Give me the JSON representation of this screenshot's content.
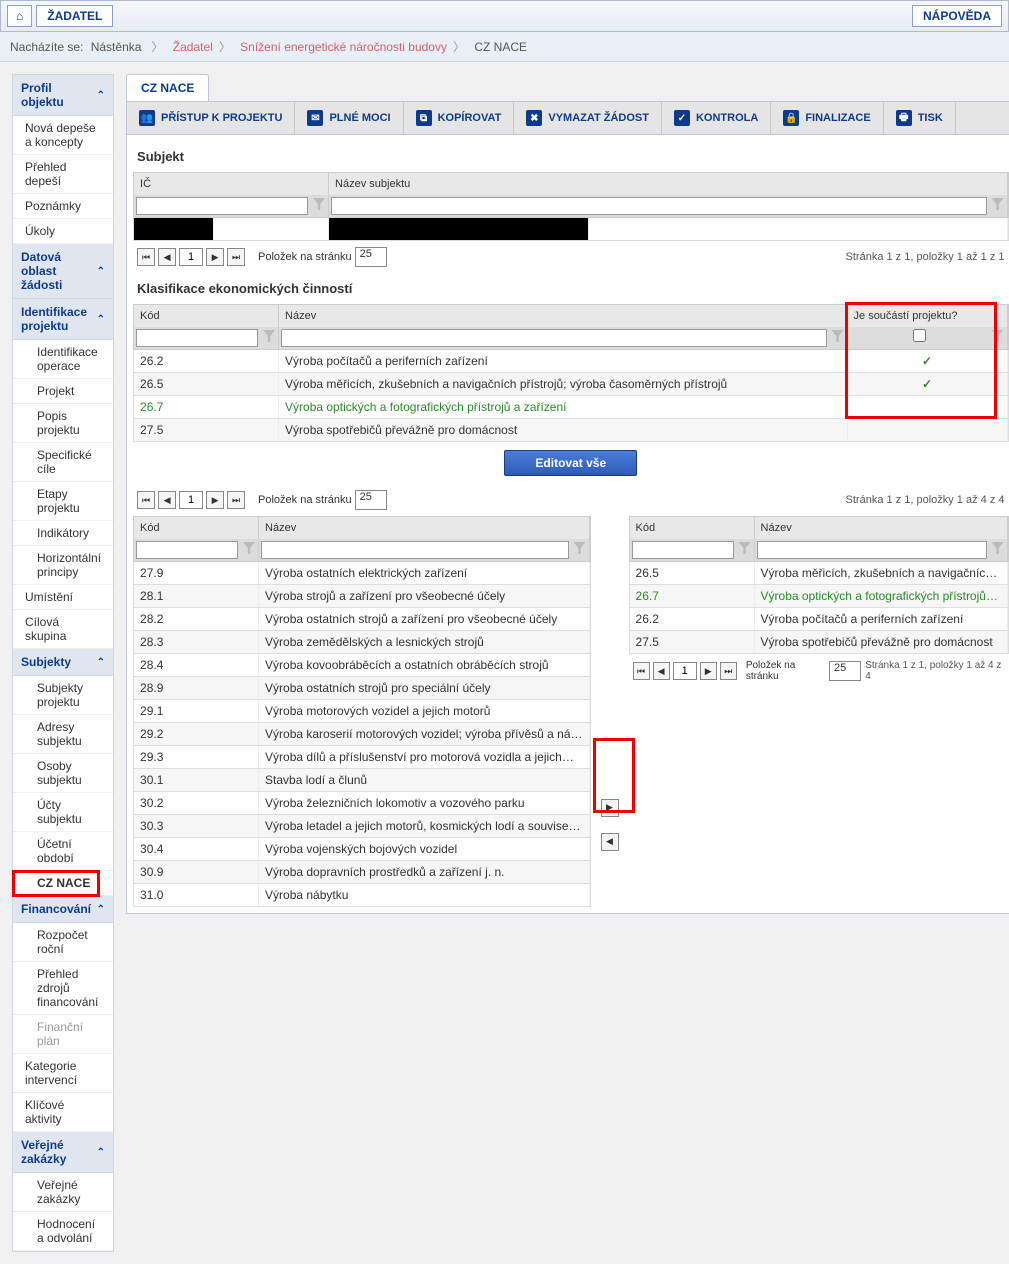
{
  "topbar": {
    "home": "⌂",
    "zadatel": "ŽADATEL",
    "napoveda": "NÁPOVĚDA"
  },
  "breadcrumb": {
    "label": "Nacházíte se:",
    "items": [
      "Nástěnka",
      "Žadatel",
      "Snížení energetické náročnosti budovy",
      "CZ NACE"
    ]
  },
  "sidebar": {
    "groups": [
      {
        "title": "Profil objektu",
        "items": [
          "Nová depeše a koncepty",
          "Přehled depeší",
          "Poznámky",
          "Úkoly"
        ]
      },
      {
        "title": "Datová oblast žádosti"
      },
      {
        "title": "Identifikace projektu",
        "items": [
          "Identifikace operace",
          "Projekt",
          "Popis projektu",
          "Specifické cíle",
          "Etapy projektu",
          "Indikátory",
          "Horizontální principy"
        ]
      }
    ],
    "umisteni": "Umístění",
    "cilova": "Cílová skupina",
    "subjekty": {
      "title": "Subjekty",
      "items": [
        "Subjekty projektu",
        "Adresy subjektu",
        "Osoby subjektu",
        "Účty subjektu",
        "Účetní období",
        "CZ NACE"
      ]
    },
    "financovani": {
      "title": "Financování",
      "items": [
        "Rozpočet roční",
        "Přehled zdrojů financování",
        "Finanční plán"
      ]
    },
    "kategorie": "Kategorie intervencí",
    "klicove": "Klíčové aktivity",
    "verejne": {
      "title": "Veřejné zakázky",
      "items": [
        "Veřejné zakázky",
        "Hodnocení a odvolání"
      ]
    }
  },
  "tab": "CZ NACE",
  "tools": {
    "pristup": "PŘÍSTUP K PROJEKTU",
    "plne_moci": "PLNÉ MOCI",
    "kopirovat": "KOPÍROVAT",
    "vymazat": "VYMAZAT ŽÁDOST",
    "kontrola": "KONTROLA",
    "finalizace": "FINALIZACE",
    "tisk": "TISK"
  },
  "subjekt": {
    "title": "Subjekt",
    "col_ic": "IČ",
    "col_nazev": "Název subjektu",
    "pager_text": "Stránka 1 z 1, položky 1 až 1 z 1",
    "polozek": "Položek na stránku",
    "per_page": "25",
    "page": "1"
  },
  "klasifikace": {
    "title": "Klasifikace ekonomických činností",
    "col_kod": "Kód",
    "col_nazev": "Název",
    "col_soucasti": "Je součástí projektu?",
    "rows": [
      {
        "kod": "26.2",
        "nazev": "Výroba počítačů a periferních zařízení",
        "check": true
      },
      {
        "kod": "26.5",
        "nazev": "Výroba měřicích, zkušebních a navigačních přístrojů; výroba časoměrných přístrojů",
        "check": true
      },
      {
        "kod": "26.7",
        "nazev": "Výroba optických a fotografických přístrojů a zařízení",
        "green": true
      },
      {
        "kod": "27.5",
        "nazev": "Výroba spotřebičů převážně pro domácnost"
      }
    ],
    "edit_btn": "Editovat vše",
    "pager_text": "Stránka 1 z 1, položky 1 až 4 z 4",
    "polozek": "Položek na stránku",
    "per_page": "25",
    "page": "1"
  },
  "left_grid": {
    "col_kod": "Kód",
    "col_nazev": "Název",
    "rows": [
      {
        "kod": "27.9",
        "nazev": "Výroba ostatních elektrických zařízení"
      },
      {
        "kod": "28.1",
        "nazev": "Výroba strojů a zařízení pro všeobecné účely"
      },
      {
        "kod": "28.2",
        "nazev": "Výroba ostatních strojů a zařízení pro všeobecné účely"
      },
      {
        "kod": "28.3",
        "nazev": "Výroba zemědělských a lesnických strojů"
      },
      {
        "kod": "28.4",
        "nazev": "Výroba kovoobráběcích a ostatních obráběcích strojů"
      },
      {
        "kod": "28.9",
        "nazev": "Výroba ostatních strojů pro speciální účely"
      },
      {
        "kod": "29.1",
        "nazev": "Výroba motorových vozidel a jejich motorů"
      },
      {
        "kod": "29.2",
        "nazev": "Výroba karoserií motorových vozidel; výroba přívěsů a ná…"
      },
      {
        "kod": "29.3",
        "nazev": "Výroba dílů a příslušenství pro motorová vozidla a jejich…"
      },
      {
        "kod": "30.1",
        "nazev": "Stavba lodí a člunů"
      },
      {
        "kod": "30.2",
        "nazev": "Výroba železničních lokomotiv a vozového parku"
      },
      {
        "kod": "30.3",
        "nazev": "Výroba letadel a jejich motorů, kosmických lodí a souvise…"
      },
      {
        "kod": "30.4",
        "nazev": "Výroba vojenských bojových vozidel"
      },
      {
        "kod": "30.9",
        "nazev": "Výroba dopravních prostředků a zařízení j. n."
      },
      {
        "kod": "31.0",
        "nazev": "Výroba nábytku"
      }
    ]
  },
  "right_grid": {
    "col_kod": "Kód",
    "col_nazev": "Název",
    "rows": [
      {
        "kod": "26.5",
        "nazev": "Výroba měřicích, zkušebních a navigačních přístrojů; výr…"
      },
      {
        "kod": "26.7",
        "nazev": "Výroba optických a fotografických přístrojů a zařízení",
        "green": true
      },
      {
        "kod": "26.2",
        "nazev": "Výroba počítačů a periferních zařízení"
      },
      {
        "kod": "27.5",
        "nazev": "Výroba spotřebičů převážně pro domácnost"
      }
    ],
    "pager_text": "Stránka 1 z 1, položky 1 až 4 z 4",
    "polozek": "Položek na stránku",
    "per_page": "25",
    "page": "1"
  }
}
